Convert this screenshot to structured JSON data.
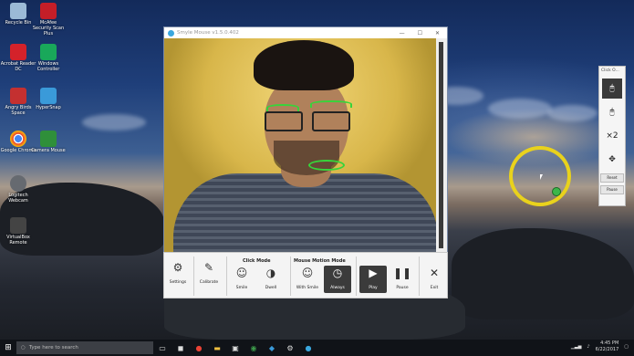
{
  "desktop_icons": [
    {
      "label": "Recycle Bin",
      "color": "#9bbad6"
    },
    {
      "label": "McAfee Security Scan Plus",
      "color": "#c41e28"
    },
    {
      "label": "Acrobat Reader DC",
      "color": "#d4222a"
    },
    {
      "label": "Windows Controller",
      "color": "#19a85a"
    },
    {
      "label": "Angry Birds Space",
      "color": "#c43030"
    },
    {
      "label": "HyperSnap",
      "color": "#3a9ad9"
    },
    {
      "label": "Google Chrome",
      "color": "#e94235"
    },
    {
      "label": "Camera Mouse",
      "color": "#2f8f3a"
    },
    {
      "label": "Logitech Webcam",
      "color": "#666a70"
    },
    {
      "label": "VirtualBox Remote",
      "color": "#444"
    }
  ],
  "app_window": {
    "title": "Smyle Mouse v1.5.0.402",
    "controls": [
      "—",
      "☐",
      "✕"
    ]
  },
  "toolbar": {
    "settings": "Settings",
    "calibrate": "Calibrate",
    "click_mode_title": "Click Mode",
    "smile": "Smile",
    "dwell": "Dwell",
    "motion_mode_title": "Mouse Motion Mode",
    "with_smile": "With Smile",
    "always": "Always",
    "play": "Play",
    "pause": "Pause",
    "exit": "Exit"
  },
  "click_panel": {
    "title": "Click O...",
    "buttons": [
      "left-click",
      "right-click",
      "double-click",
      "drag"
    ],
    "double_label": "×2",
    "reset": "Reset",
    "pause": "Pause"
  },
  "taskbar": {
    "search_placeholder": "Type here to search",
    "time": "4:45 PM",
    "date": "6/22/2017"
  }
}
